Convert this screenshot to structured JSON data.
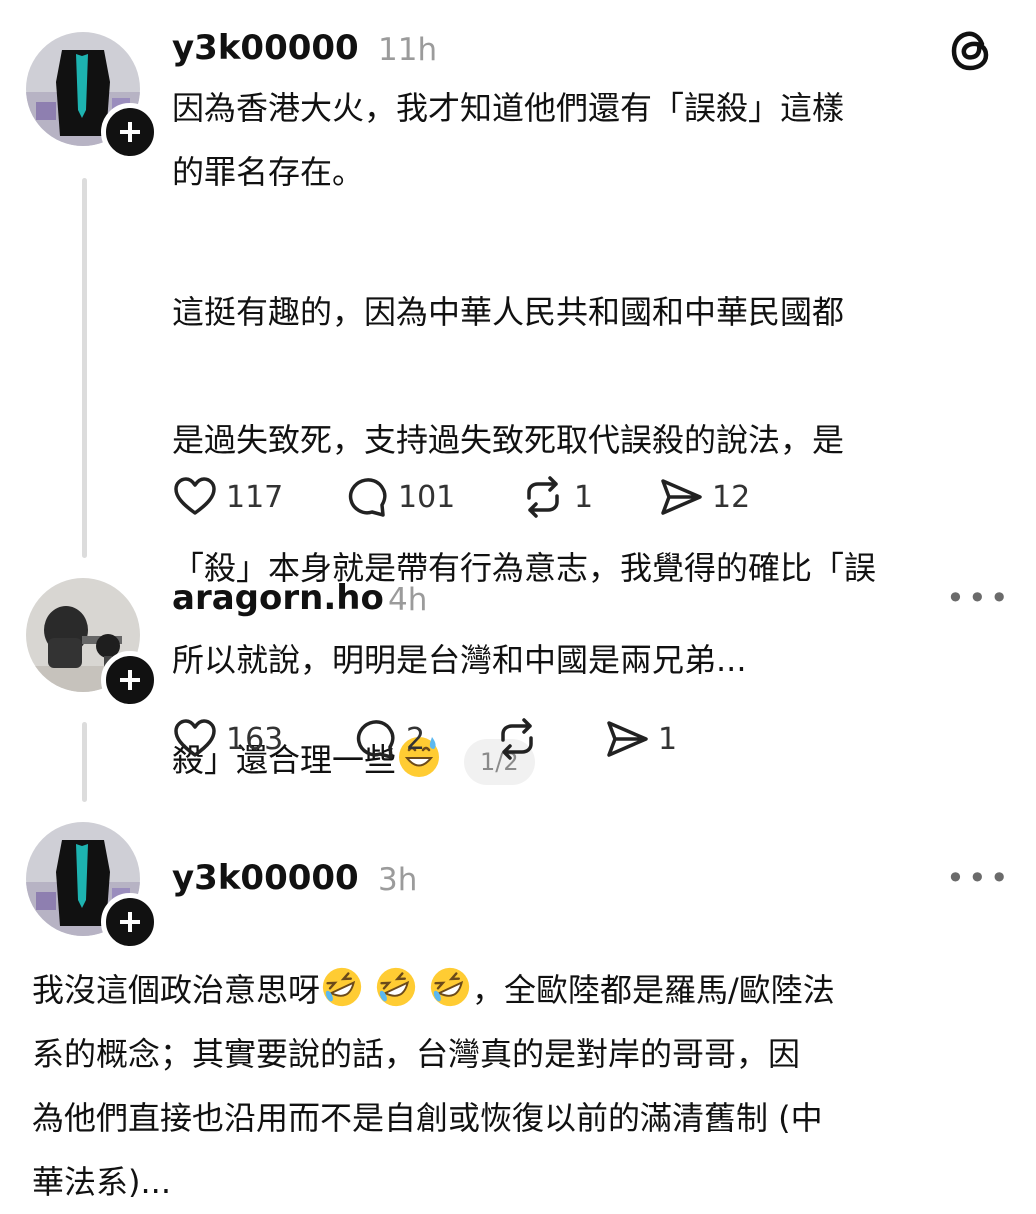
{
  "posts": [
    {
      "username": "y3k00000",
      "time": "11h",
      "paragraph1": "因為香港大火，我才知道他們還有「誤殺」這樣\n的罪名存在。",
      "paragraph2_lines": [
        "這挺有趣的，因為中華人民共和國和中華民國都",
        "是過失致死，支持過失致死取代誤殺的說法，是",
        "「殺」本身就是帶有行為意志，我覺得的確比「誤",
        "殺」還合理一些"
      ],
      "page_indicator": "1/2",
      "emoji": "grinning-sweat-emoji",
      "likes": "117",
      "replies": "101",
      "reposts": "1",
      "shares": "12"
    },
    {
      "username": "aragorn.ho",
      "time": "4h",
      "text": "所以就說，明明是台灣和中國是兩兄弟...",
      "likes": "163",
      "replies": "2",
      "reposts": "",
      "shares": "1"
    },
    {
      "username": "y3k00000",
      "time": "3h",
      "line1_a": "我沒這個政治意思呀",
      "emoji": "rolling-laughing-emoji",
      "line1_b": "，全歐陸都是羅馬/歐陸法",
      "rest": "系的概念；其實要說的話，台灣真的是對岸的哥哥，因\n為他們直接也沿用而不是自創或恢復以前的滿清舊制 (中\n華法系)..."
    }
  ],
  "icons": {
    "app": "threads-logo-icon",
    "more": "more-options-icon",
    "follow": "follow-plus-icon",
    "like": "heart-icon",
    "reply": "comment-icon",
    "repost": "repost-icon",
    "share": "share-icon"
  },
  "more_label": "•••"
}
